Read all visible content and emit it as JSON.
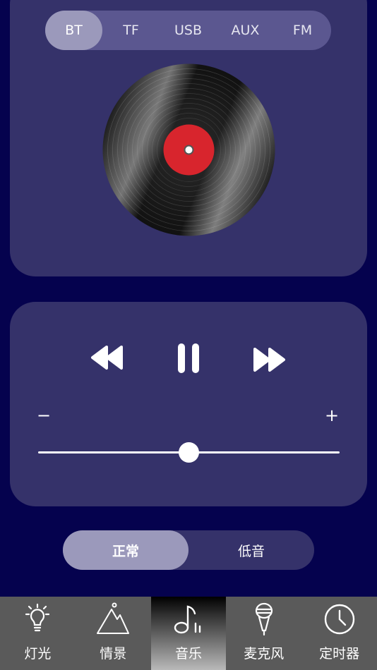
{
  "sources": {
    "tabs": [
      "BT",
      "TF",
      "USB",
      "AUX",
      "FM"
    ],
    "selected": "BT"
  },
  "volume": {
    "minus_label": "−",
    "plus_label": "+",
    "level": 0.5
  },
  "sound_mode": {
    "options": [
      "正常",
      "低音"
    ],
    "selected": "正常"
  },
  "tabbar": {
    "items": [
      {
        "label": "灯光",
        "icon": "bulb-icon"
      },
      {
        "label": "情景",
        "icon": "mountain-icon"
      },
      {
        "label": "音乐",
        "icon": "music-note-icon"
      },
      {
        "label": "麦克风",
        "icon": "microphone-icon"
      },
      {
        "label": "定时器",
        "icon": "clock-icon"
      }
    ],
    "selected": "音乐"
  },
  "colors": {
    "background": "#05024e",
    "panel": "#35326a",
    "tab_track": "#5b5790",
    "tab_active": "#9b99bb",
    "disc_label": "#d8252d"
  }
}
